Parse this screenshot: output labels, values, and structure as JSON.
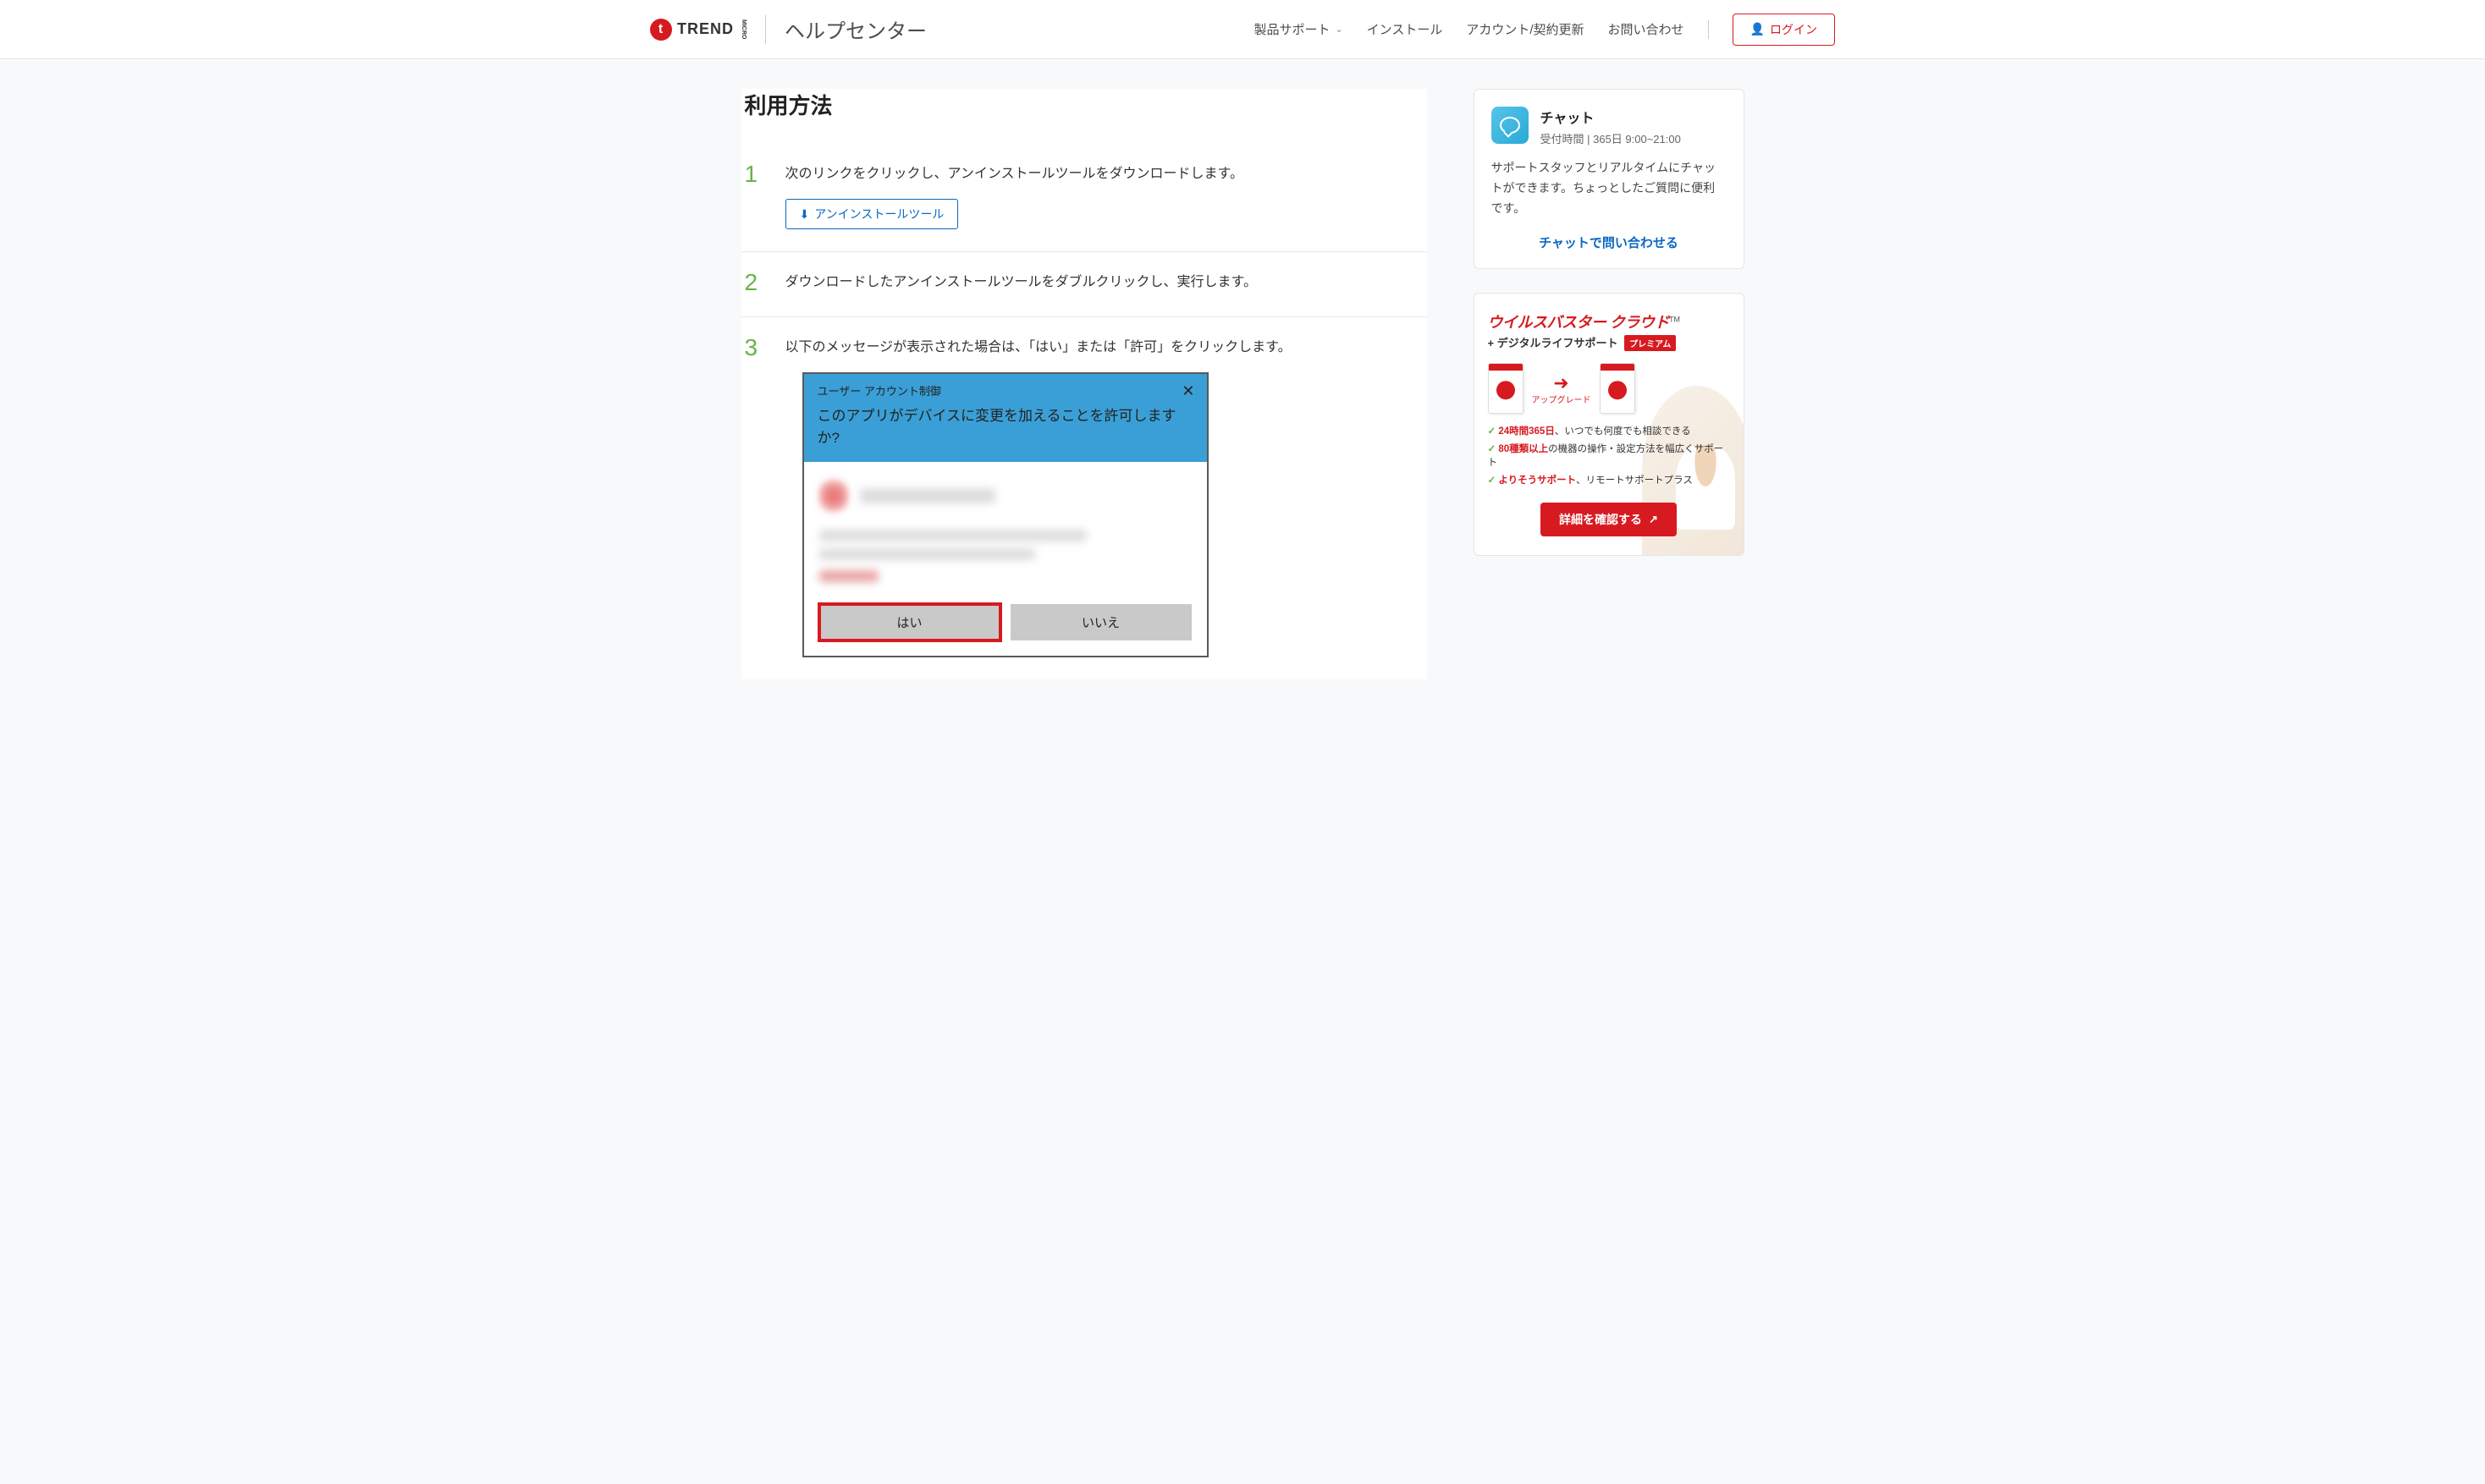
{
  "header": {
    "brand": "TREND",
    "brand_micro": "MICRO",
    "help_center": "ヘルプセンター",
    "nav": {
      "product_support": "製品サポート",
      "install": "インストール",
      "account": "アカウント/契約更新",
      "contact": "お問い合わせ"
    },
    "login": "ログイン"
  },
  "main": {
    "title": "利用方法",
    "steps": [
      {
        "num": "1",
        "text": "次のリンクをクリックし、アンインストールツールをダウンロードします。",
        "button": "アンインストールツール"
      },
      {
        "num": "2",
        "text": "ダウンロードしたアンインストールツールをダブルクリックし、実行します。"
      },
      {
        "num": "3",
        "text": "以下のメッセージが表示された場合は、「はい」または「許可」をクリックします。"
      }
    ],
    "uac": {
      "title": "ユーザー アカウント制御",
      "question": "このアプリがデバイスに変更を加えることを許可しますか?",
      "yes": "はい",
      "no": "いいえ"
    }
  },
  "sidebar": {
    "chat": {
      "title": "チャット",
      "hours": "受付時間 | 365日 9:00~21:00",
      "desc": "サポートスタッフとリアルタイムにチャットができます。ちょっとしたご質問に便利です。",
      "link": "チャットで問い合わせる"
    },
    "promo": {
      "title": "ウイルスバスター クラウド",
      "tm": "TM",
      "subtitle": "+ デジタルライフサポート",
      "premium": "プレミアム",
      "upgrade": "アップグレード",
      "bullets": [
        {
          "em": "24時間365日",
          "rest": "、いつでも何度でも相談できる"
        },
        {
          "em": "80種類以上",
          "rest": "の機器の操作・設定方法を幅広くサポート"
        },
        {
          "em": "よりそうサポート",
          "rest": "、リモートサポートプラス"
        }
      ],
      "cta": "詳細を確認する"
    }
  }
}
